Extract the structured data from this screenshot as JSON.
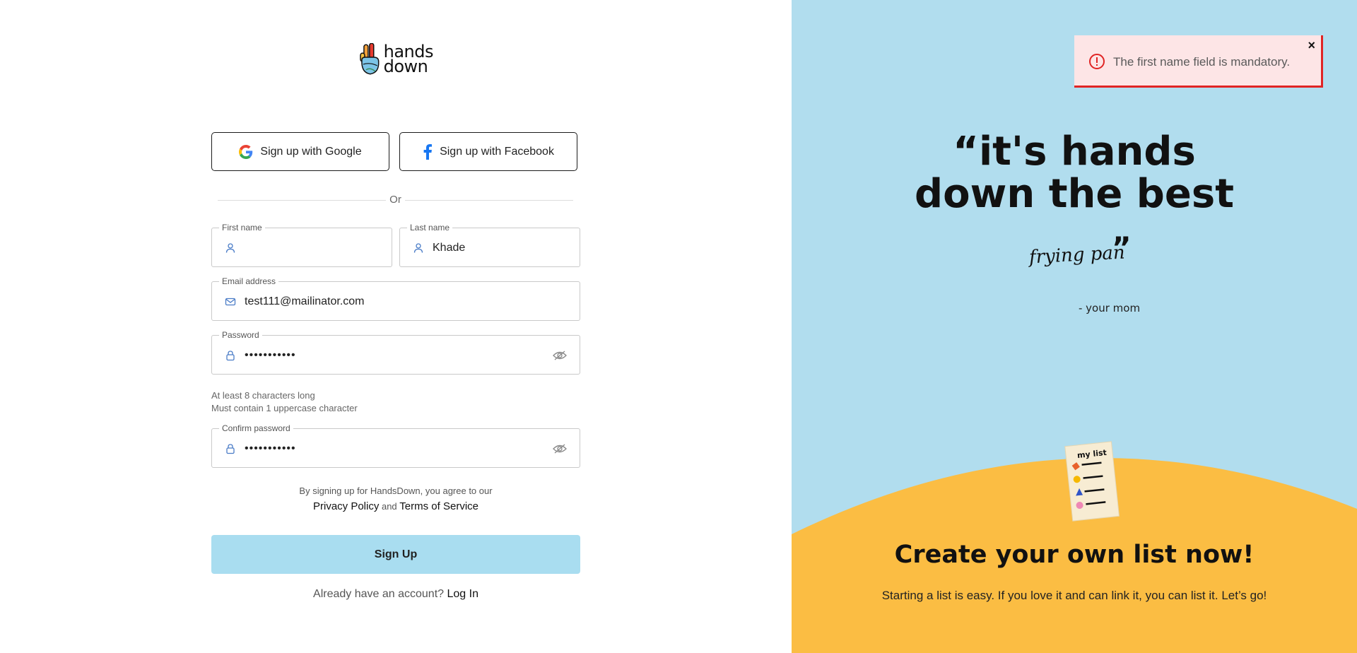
{
  "brand": {
    "line1": "hands",
    "line2": "down"
  },
  "social": {
    "google_label": "Sign up with Google",
    "facebook_label": "Sign up with Facebook"
  },
  "divider_text": "Or",
  "form": {
    "first_name": {
      "label": "First name",
      "value": ""
    },
    "last_name": {
      "label": "Last name",
      "value": "Khade"
    },
    "email": {
      "label": "Email address",
      "value": "test111@mailinator.com"
    },
    "password": {
      "label": "Password",
      "value": "•••••••••••"
    },
    "password_hints": [
      "At least 8 characters long",
      "Must contain 1 uppercase character"
    ],
    "confirm_password": {
      "label": "Confirm password",
      "value": "•••••••••••"
    }
  },
  "terms": {
    "prefix": "By signing up for HandsDown, you agree to our",
    "privacy": "Privacy Policy",
    "and": "and",
    "tos": "Terms of Service"
  },
  "signup_button": "Sign Up",
  "login": {
    "prompt": "Already have an account?",
    "link": "Log In"
  },
  "toast": {
    "message": "The first name field is mandatory.",
    "close": "×"
  },
  "hero": {
    "quote_line1": "“it's hands",
    "quote_line2": "down the best",
    "cursive": "frying pan",
    "close_quote": "”",
    "attribution": "- your mom"
  },
  "note_card": {
    "title": "my list"
  },
  "cta": {
    "title": "Create your own list now!",
    "subtitle": "Starting a list is easy. If you love it and can link it, you can list it. Let’s go!"
  },
  "colors": {
    "panel_bg": "#b1ddee",
    "hill": "#fbbd43",
    "button": "#a9ddf0",
    "error": "#e02424",
    "toast_bg": "#fde5e6"
  }
}
